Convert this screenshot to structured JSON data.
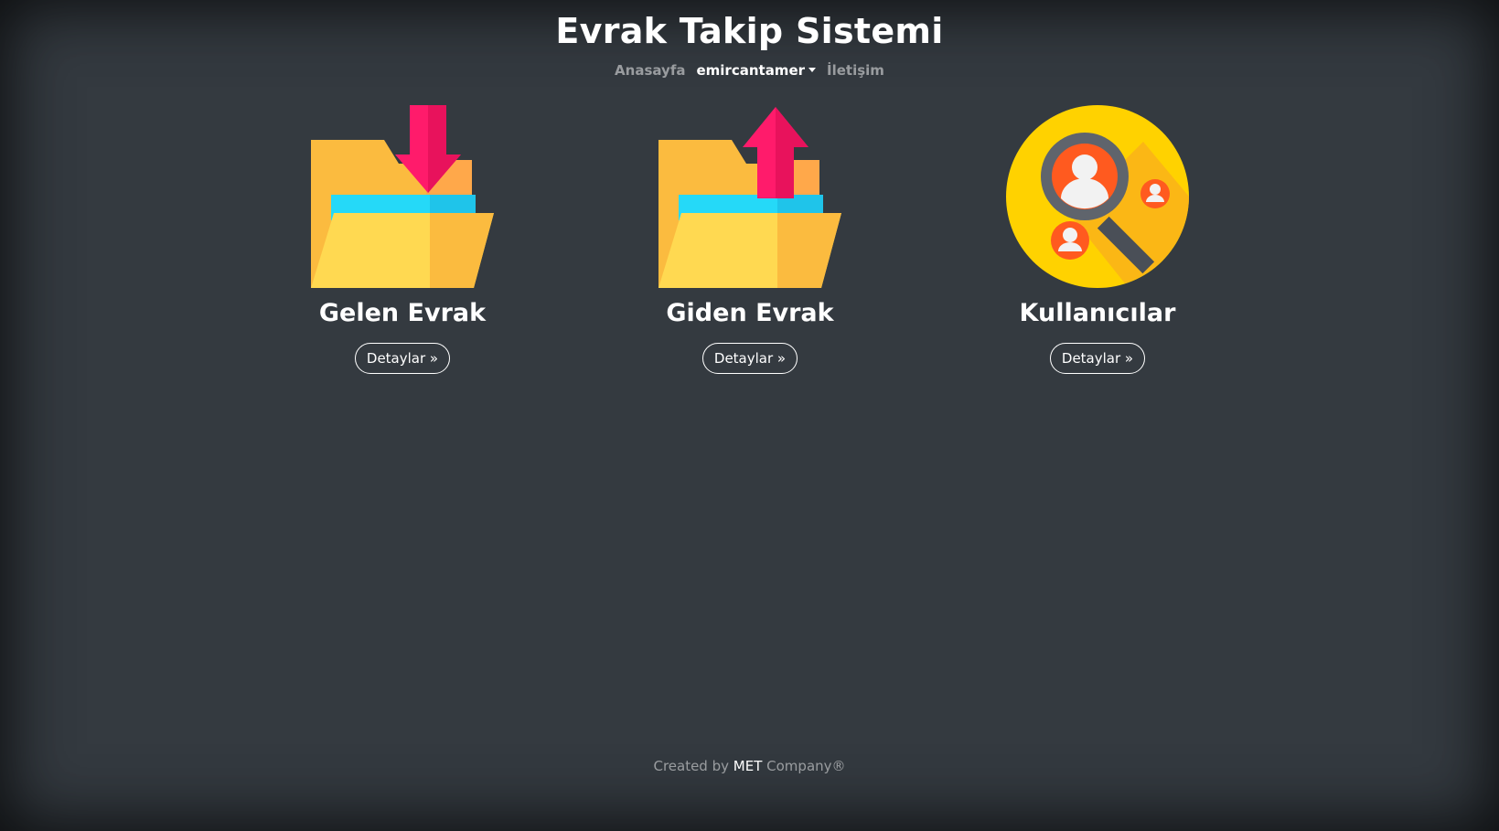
{
  "header": {
    "title": "Evrak Takip Sistemi",
    "nav": {
      "home": "Anasayfa",
      "user": "emircantamer",
      "contact": "İletişim"
    }
  },
  "cards": [
    {
      "title": "Gelen Evrak",
      "button": "Detaylar »",
      "icon": "folder-download-icon"
    },
    {
      "title": "Giden Evrak",
      "button": "Detaylar »",
      "icon": "folder-upload-icon"
    },
    {
      "title": "Kullanıcılar",
      "button": "Detaylar »",
      "icon": "user-search-icon"
    }
  ],
  "footer": {
    "prefix": "Created by",
    "brand": "MET",
    "suffix": "Company®"
  },
  "colors": {
    "background": "#343a40",
    "folder_back": "#fbbb3f",
    "folder_front": "#ffd951",
    "folder_paper": "#25d9f8",
    "arrow": "#ff1b6b",
    "user_circle": "#ffd200",
    "user_badge": "#ff5a1f"
  }
}
